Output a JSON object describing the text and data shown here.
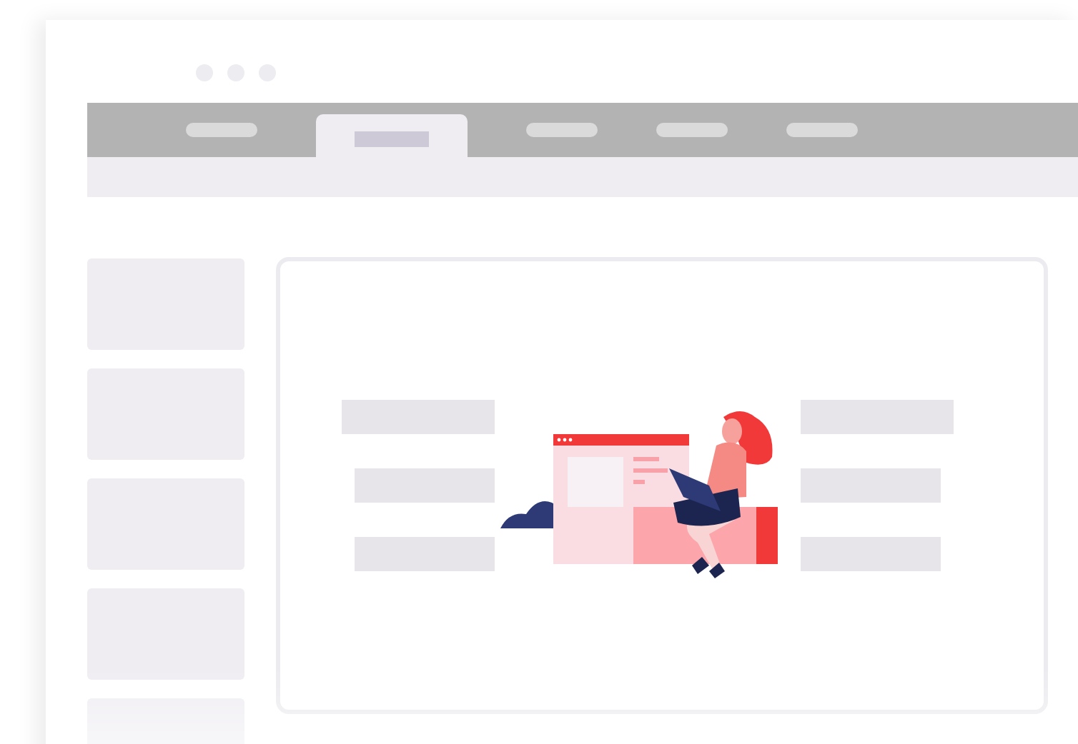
{
  "window": {
    "controls": [
      {
        "kind": "dot"
      },
      {
        "kind": "dot"
      },
      {
        "kind": "dot"
      }
    ]
  },
  "tabs": [
    {
      "selected": false
    },
    {
      "selected": true
    },
    {
      "selected": false
    },
    {
      "selected": false
    },
    {
      "selected": false
    }
  ],
  "sidebar": {
    "items": [
      {
        "kind": "tile"
      },
      {
        "kind": "tile"
      },
      {
        "kind": "tile"
      },
      {
        "kind": "tile"
      },
      {
        "kind": "tile"
      }
    ]
  },
  "content": {
    "left_bars": [
      {
        "kind": "wide"
      },
      {
        "kind": "narrow"
      },
      {
        "kind": "narrow"
      }
    ],
    "right_bars": [
      {
        "kind": "wide"
      },
      {
        "kind": "narrow"
      },
      {
        "kind": "narrow"
      }
    ]
  }
}
